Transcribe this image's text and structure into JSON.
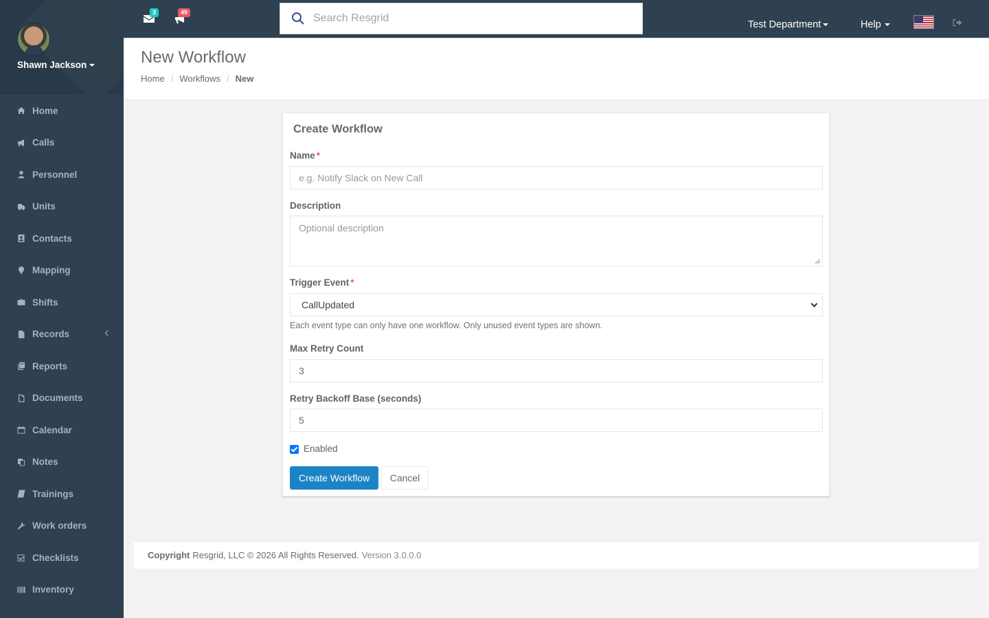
{
  "user": {
    "name": "Shawn Jackson"
  },
  "sidebar": {
    "items": [
      {
        "label": "Home",
        "icon": "home-icon"
      },
      {
        "label": "Calls",
        "icon": "megaphone-icon"
      },
      {
        "label": "Personnel",
        "icon": "user-icon"
      },
      {
        "label": "Units",
        "icon": "truck-icon"
      },
      {
        "label": "Contacts",
        "icon": "address-book-icon"
      },
      {
        "label": "Mapping",
        "icon": "map-marker-icon"
      },
      {
        "label": "Shifts",
        "icon": "briefcase-icon"
      },
      {
        "label": "Records",
        "icon": "file-icon"
      },
      {
        "label": "Reports",
        "icon": "reports-icon"
      },
      {
        "label": "Documents",
        "icon": "document-icon"
      },
      {
        "label": "Calendar",
        "icon": "calendar-icon"
      },
      {
        "label": "Notes",
        "icon": "notes-icon"
      },
      {
        "label": "Trainings",
        "icon": "book-icon"
      },
      {
        "label": "Work orders",
        "icon": "wrench-icon"
      },
      {
        "label": "Checklists",
        "icon": "checklist-icon"
      },
      {
        "label": "Inventory",
        "icon": "barcode-icon"
      }
    ]
  },
  "topbar": {
    "messages_count": "3",
    "calls_count": "49",
    "search_placeholder": "Search Resgrid",
    "department": "Test Department",
    "help": "Help",
    "badge_colors": {
      "messages": "#23c6c8",
      "calls": "#ed5565"
    }
  },
  "page": {
    "title": "New Workflow",
    "breadcrumb": [
      "Home",
      "Workflows",
      "New"
    ]
  },
  "form": {
    "card_title": "Create Workflow",
    "name_label": "Name",
    "name_placeholder": "e.g. Notify Slack on New Call",
    "description_label": "Description",
    "description_placeholder": "Optional description",
    "trigger_label": "Trigger Event",
    "trigger_value": "CallUpdated",
    "trigger_help": "Each event type can only have one workflow. Only unused event types are shown.",
    "max_retry_label": "Max Retry Count",
    "max_retry_value": "3",
    "backoff_label": "Retry Backoff Base (seconds)",
    "backoff_value": "5",
    "enabled_label": "Enabled",
    "enabled": true,
    "submit_label": "Create Workflow",
    "cancel_label": "Cancel",
    "required_mark": "*"
  },
  "footer": {
    "copyright_label": "Copyright",
    "text": "Resgrid, LLC © 2026 All Rights Reserved.",
    "version": "Version 3.0.0.0"
  },
  "colors": {
    "sidebar": "#2f4050",
    "primary": "#1c84c6"
  }
}
